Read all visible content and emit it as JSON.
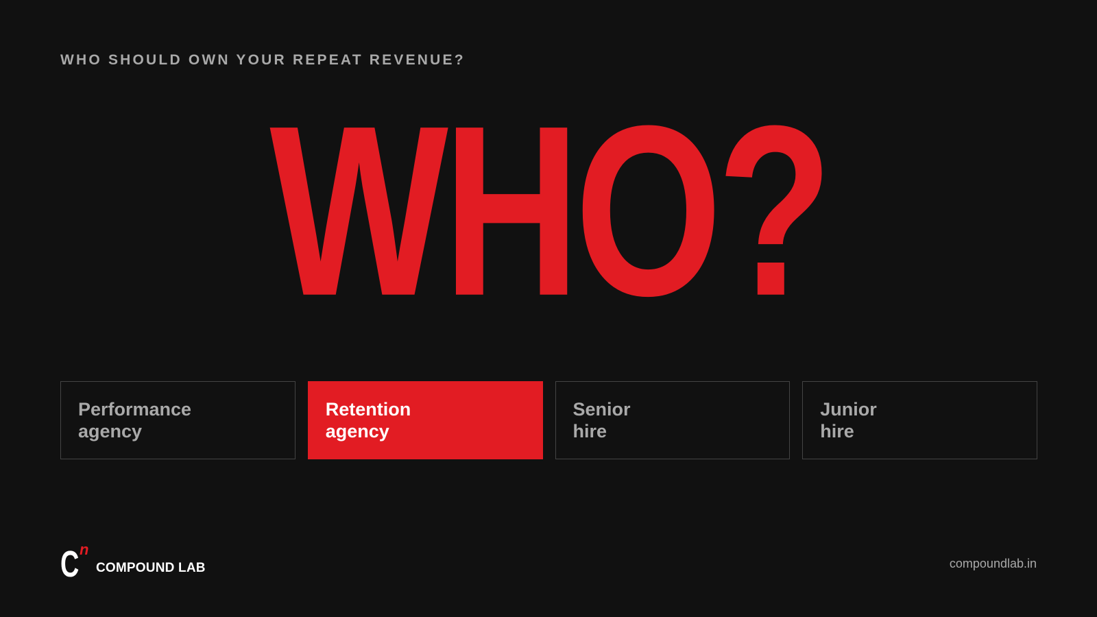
{
  "eyebrow": "WHO SHOULD OWN YOUR REPEAT REVENUE?",
  "hero": "WHO?",
  "options": [
    {
      "label": "Performance\nagency",
      "selected": false
    },
    {
      "label": "Retention\nagency",
      "selected": true
    },
    {
      "label": "Senior\nhire",
      "selected": false
    },
    {
      "label": "Junior\nhire",
      "selected": false
    }
  ],
  "logo": {
    "mark": "C",
    "superscript": "n",
    "name": "COMPOUND LAB"
  },
  "footer_url": "compoundlab.in",
  "colors": {
    "background": "#111111",
    "accent": "#e21c23",
    "muted_text": "#a9a9a9",
    "border": "#444444",
    "white": "#ffffff"
  }
}
